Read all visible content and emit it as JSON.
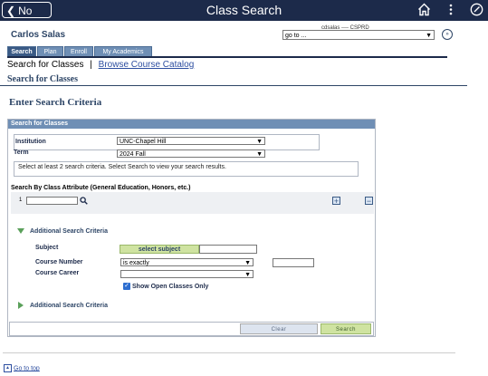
{
  "header": {
    "back_label": "No Data",
    "title": "Class Search"
  },
  "user_name": "Carlos Salas",
  "server_info": "cdsalas ---- CSPRD",
  "goto": {
    "value": "go to ..."
  },
  "tabs": [
    {
      "label": "Search"
    },
    {
      "label": "Plan"
    },
    {
      "label": "Enroll"
    },
    {
      "label": "My Academics"
    }
  ],
  "sublinks": {
    "current": "Search for Classes",
    "separator": "|",
    "link": "Browse Course Catalog"
  },
  "page_heading": "Search for Classes",
  "enter_heading": "Enter Search Criteria",
  "section": {
    "title": "Search for Classes",
    "institution_label": "Institution",
    "institution_value": "UNC-Chapel Hill",
    "term_label": "Term",
    "term_value": "2024 Fall",
    "message": "Select at least 2 search criteria. Select Search to view your search results.",
    "attr_heading": "Search By Class Attribute (General Education, Honors, etc.)",
    "attr_row_num": "1",
    "add_plus": "+",
    "remove_minus": "−",
    "additional_heading": "Additional Search Criteria",
    "subject_label": "Subject",
    "select_subject_label": "select subject",
    "course_number_label": "Course Number",
    "course_number_op": "is exactly",
    "course_career_label": "Course Career",
    "open_classes_label": "Show Open Classes Only",
    "additional_heading_2": "Additional Search Criteria",
    "clear_label": "Clear",
    "search_label": "Search"
  },
  "footer": {
    "go_to_top": "Go to top"
  }
}
